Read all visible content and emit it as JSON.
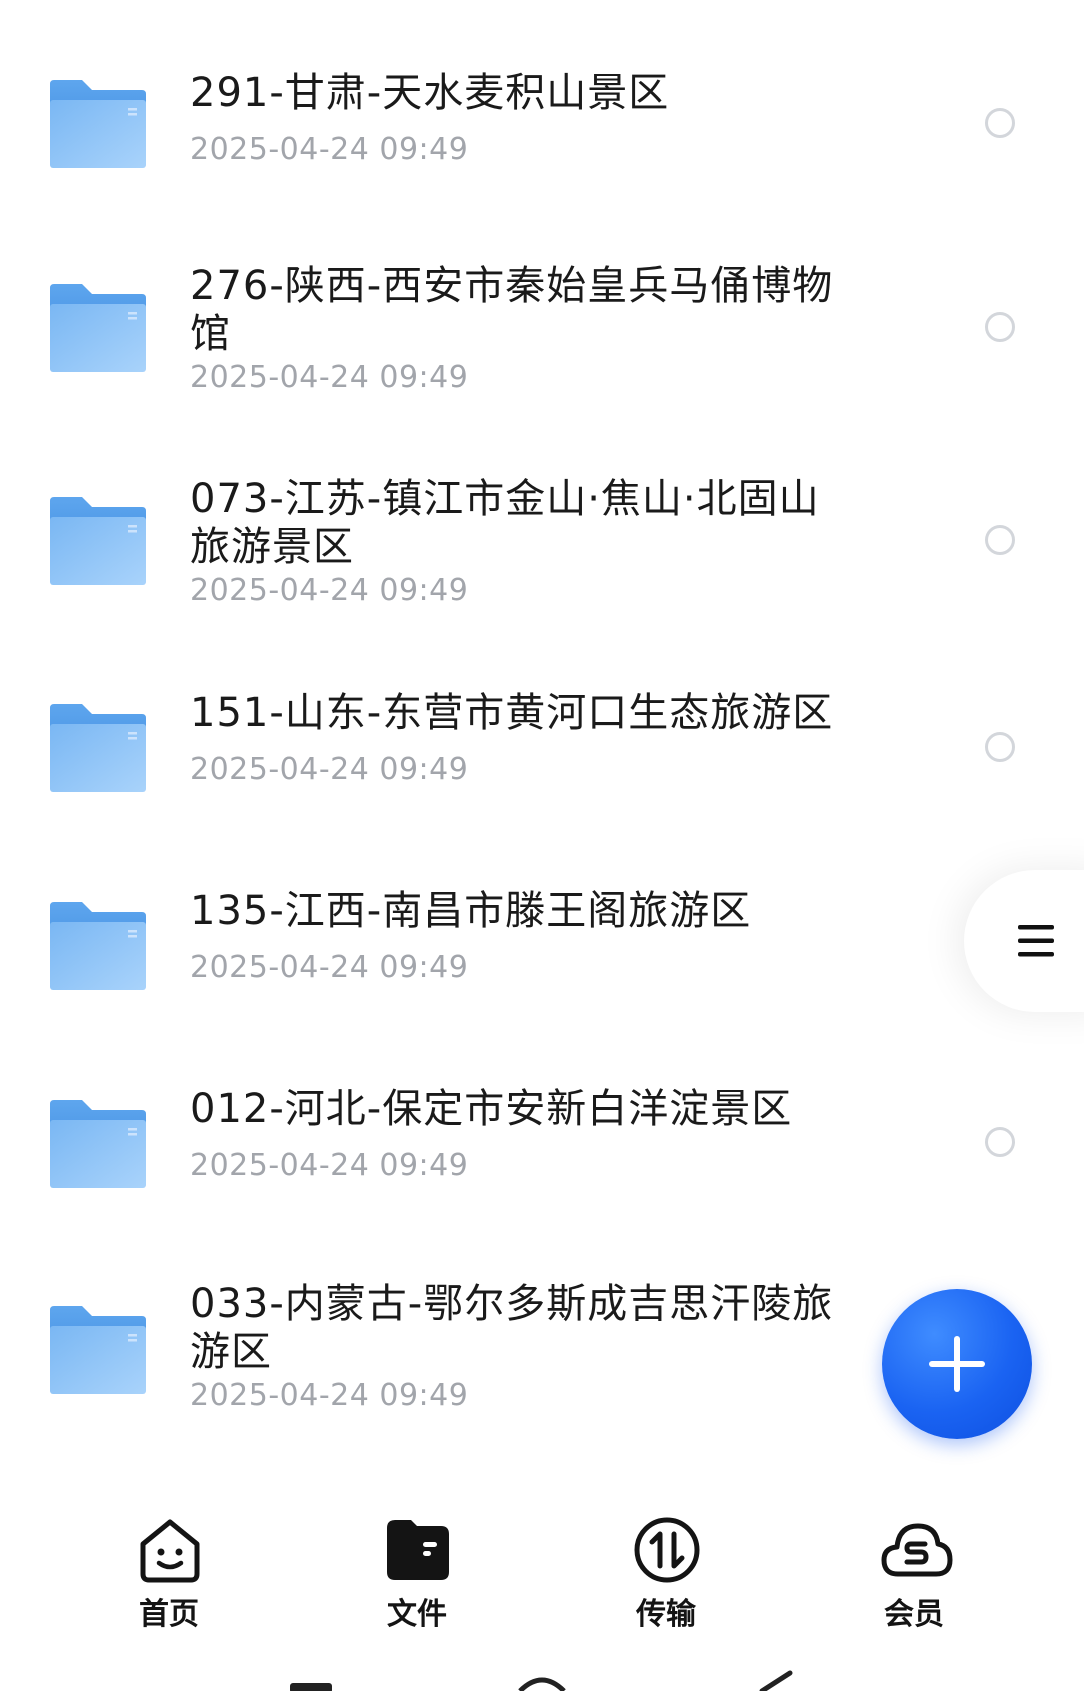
{
  "files": [
    {
      "name": "291-甘肃-天水麦积山景区",
      "date": "2025-04-24 09:49"
    },
    {
      "name": "276-陕西-西安市秦始皇兵马俑博物馆",
      "date": "2025-04-24 09:49"
    },
    {
      "name": "073-江苏-镇江市金山·焦山·北固山旅游景区",
      "date": "2025-04-24 09:49"
    },
    {
      "name": "151-山东-东营市黄河口生态旅游区",
      "date": "2025-04-24 09:49"
    },
    {
      "name": "135-江西-南昌市滕王阁旅游区",
      "date": "2025-04-24 09:49"
    },
    {
      "name": "012-河北-保定市安新白洋淀景区",
      "date": "2025-04-24 09:49"
    },
    {
      "name": "033-内蒙古-鄂尔多斯成吉思汗陵旅游区",
      "date": "2025-04-24 09:49"
    }
  ],
  "icons": {
    "folder": "folder-icon",
    "menu": "menu-icon",
    "add": "plus-icon"
  },
  "colors": {
    "accent": "#1a63f2",
    "folder": "#7fbaf2"
  },
  "bottom_nav": {
    "items": [
      {
        "label": "首页",
        "icon": "home-smile-icon"
      },
      {
        "label": "文件",
        "icon": "wallet-folder-icon",
        "active": true
      },
      {
        "label": "传输",
        "icon": "transfer-icon"
      },
      {
        "label": "会员",
        "icon": "member-cloud-icon"
      }
    ]
  }
}
